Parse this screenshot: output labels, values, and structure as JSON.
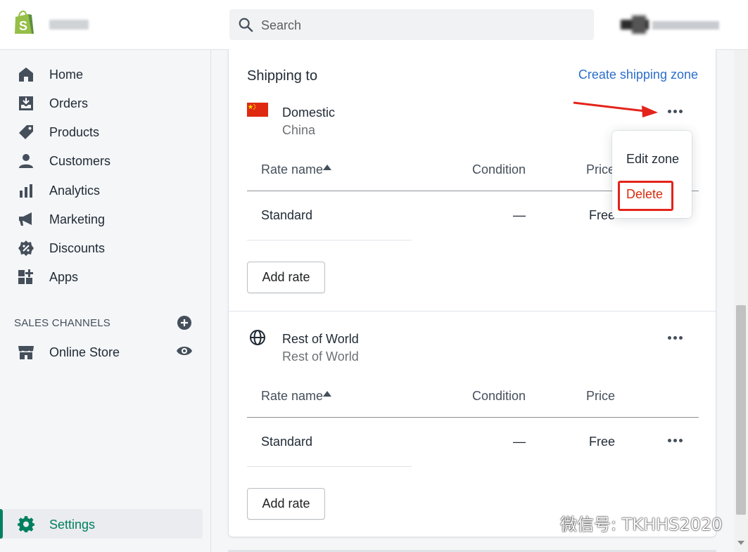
{
  "topbar": {
    "search_placeholder": "Search"
  },
  "sidebar": {
    "items": [
      {
        "label": "Home",
        "icon": "home-icon"
      },
      {
        "label": "Orders",
        "icon": "orders-icon"
      },
      {
        "label": "Products",
        "icon": "tag-icon"
      },
      {
        "label": "Customers",
        "icon": "person-icon"
      },
      {
        "label": "Analytics",
        "icon": "bar-chart-icon"
      },
      {
        "label": "Marketing",
        "icon": "megaphone-icon"
      },
      {
        "label": "Discounts",
        "icon": "discount-icon"
      },
      {
        "label": "Apps",
        "icon": "apps-icon"
      }
    ],
    "sales_channels_label": "SALES CHANNELS",
    "online_store_label": "Online Store",
    "settings_label": "Settings"
  },
  "main": {
    "heading": "Shipping to",
    "create_zone_label": "Create shipping zone",
    "columns": {
      "rate_name": "Rate name",
      "condition": "Condition",
      "price": "Price"
    },
    "zones": [
      {
        "title": "Domestic",
        "subtitle": "China",
        "icon": "china-flag-icon",
        "rates": [
          {
            "name": "Standard",
            "condition": "—",
            "price": "Free"
          }
        ],
        "add_rate_label": "Add rate"
      },
      {
        "title": "Rest of World",
        "subtitle": "Rest of World",
        "icon": "globe-icon",
        "rates": [
          {
            "name": "Standard",
            "condition": "—",
            "price": "Free"
          }
        ],
        "add_rate_label": "Add rate"
      }
    ]
  },
  "popover": {
    "edit_label": "Edit zone",
    "delete_label": "Delete"
  },
  "watermark": {
    "text": "微信号: TKHHS2020"
  },
  "colors": {
    "brand_green": "#008060",
    "link_blue": "#2c6ecb",
    "danger_red": "#d72c0d",
    "annotation_red": "#e3241b"
  }
}
